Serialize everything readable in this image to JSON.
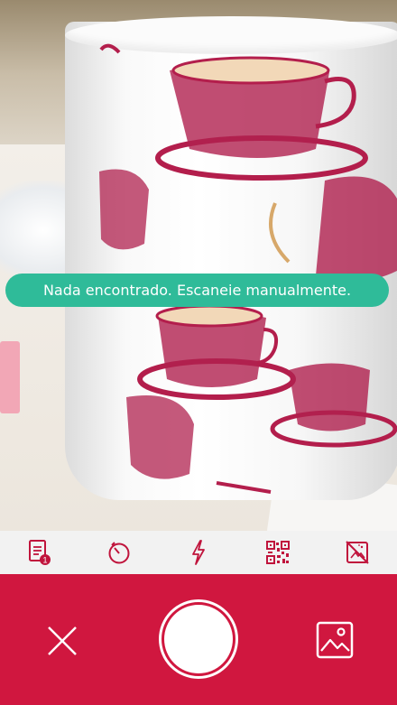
{
  "toast": {
    "message": "Nada encontrado. Escaneie manualmente."
  },
  "toolbar": {
    "items": [
      {
        "icon": "document-badge-icon",
        "badge": "1"
      },
      {
        "icon": "timer-icon"
      },
      {
        "icon": "flash-icon"
      },
      {
        "icon": "qr-code-icon"
      },
      {
        "icon": "no-photo-enhance-icon"
      }
    ]
  },
  "colors": {
    "accent": "#d0173f",
    "toast": "#2fbb99",
    "toolbar_icons": "#c0143c"
  }
}
